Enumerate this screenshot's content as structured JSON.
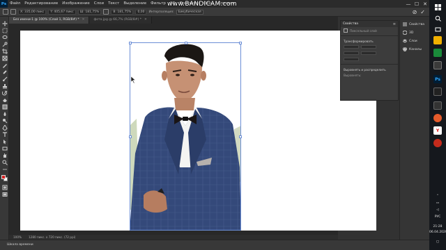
{
  "app": {
    "logo": "Ps",
    "menu": [
      "Файл",
      "Редактирование",
      "Изображение",
      "Слои",
      "Текст",
      "Выделение",
      "Фильтр",
      "3D",
      "Просмотр",
      "Окно",
      "Справка"
    ],
    "window_buttons": {
      "minimize": "—",
      "maximize": "☐",
      "close": "✕"
    }
  },
  "watermark": "www.BANDICAM.com",
  "options_bar": {
    "x_field": "X: 335,00 пикс",
    "y_field": "Y: 405,67 пикс",
    "w_field": "Ш: 181,75%",
    "h_field": "В: 181,75%",
    "angle_field": "0,00",
    "interp_label": "Интерполяция:",
    "interp_value": "Бикубическая",
    "cancel_glyph": "⊘",
    "commit_glyph": "✓"
  },
  "tabs": [
    {
      "label": "Без имени-1 @ 100% (Слой 1, RGB/8#) *",
      "active": true
    },
    {
      "label": "фото.jpg @ 66,7% (RGB/8#) *",
      "active": false
    }
  ],
  "status": {
    "zoom": "100%",
    "doc_size": "1280 пикс. x 720 пикс. (72 ppi)"
  },
  "timeline": {
    "label": "Шкала времени"
  },
  "properties": {
    "title": "Свойства",
    "layer_type": "Пиксельный слой",
    "transform_section": "Трансформировать",
    "align_section": "Выровнять и распределить",
    "align_label": "Выровнять:"
  },
  "dock": {
    "items": [
      {
        "label": "Свойства",
        "icon": "properties-icon"
      },
      {
        "label": "3D",
        "icon": "cube-icon"
      },
      {
        "label": "Слои",
        "icon": "layers-icon"
      },
      {
        "label": "Каналы",
        "icon": "channels-icon"
      }
    ]
  },
  "taskbar": {
    "lang": "РУС",
    "time": "21:28",
    "date": "06.04.2020"
  },
  "colors": {
    "accent": "#31a8ff",
    "foreground_swatch": "#d62222",
    "background_swatch": "#ffffff",
    "selection": "#6b8ed6"
  }
}
